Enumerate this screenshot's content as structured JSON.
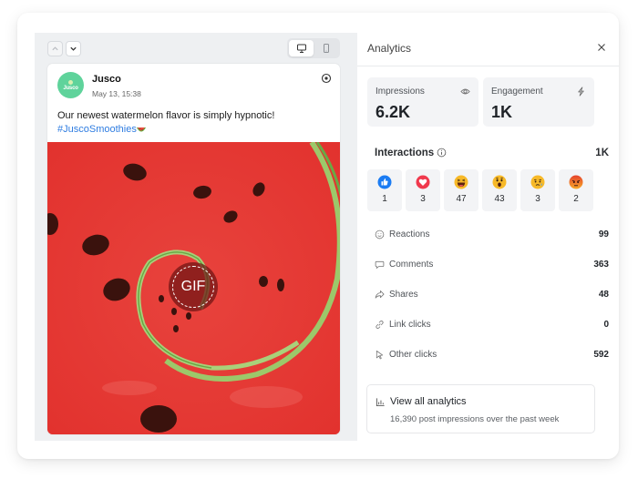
{
  "preview": {
    "nav": {
      "up_icon": "chevron-up-icon",
      "down_icon": "chevron-down-icon"
    },
    "device_toggle": {
      "options": [
        "desktop",
        "mobile"
      ],
      "selected": "desktop"
    },
    "post": {
      "avatar_text": "Jusco",
      "author": "Jusco",
      "timestamp": "May 13, 15:38",
      "text": "Our newest watermelon flavor is simply hypnotic!",
      "hashtag": "#JuscoSmoothies",
      "emoji": "watermelon",
      "media_badge": "GIF"
    }
  },
  "analytics": {
    "title": "Analytics",
    "close_icon": "close-icon",
    "stats": [
      {
        "label": "Impressions",
        "value": "6.2K",
        "icon": "eye-icon"
      },
      {
        "label": "Engagement",
        "value": "1K",
        "icon": "lightning-icon"
      }
    ],
    "interactions": {
      "title": "Interactions",
      "total": "1K",
      "reactions": [
        {
          "type": "like",
          "count": "1",
          "color": "#1877f2"
        },
        {
          "type": "love",
          "count": "3",
          "color": "#f0394d"
        },
        {
          "type": "haha",
          "count": "47",
          "color": "#f7b125"
        },
        {
          "type": "wow",
          "count": "43",
          "color": "#f7b125"
        },
        {
          "type": "sad",
          "count": "3",
          "color": "#f7b125"
        },
        {
          "type": "angry",
          "count": "2",
          "color": "#e9710f"
        }
      ]
    },
    "metrics": [
      {
        "label": "Reactions",
        "value": "99",
        "icon": "smiley-icon"
      },
      {
        "label": "Comments",
        "value": "363",
        "icon": "comment-icon"
      },
      {
        "label": "Shares",
        "value": "48",
        "icon": "share-icon"
      },
      {
        "label": "Link clicks",
        "value": "0",
        "icon": "link-icon"
      },
      {
        "label": "Other clicks",
        "value": "592",
        "icon": "cursor-icon"
      }
    ],
    "view_all": {
      "label": "View all analytics",
      "subtitle": "16,390 post impressions over the past week"
    }
  }
}
